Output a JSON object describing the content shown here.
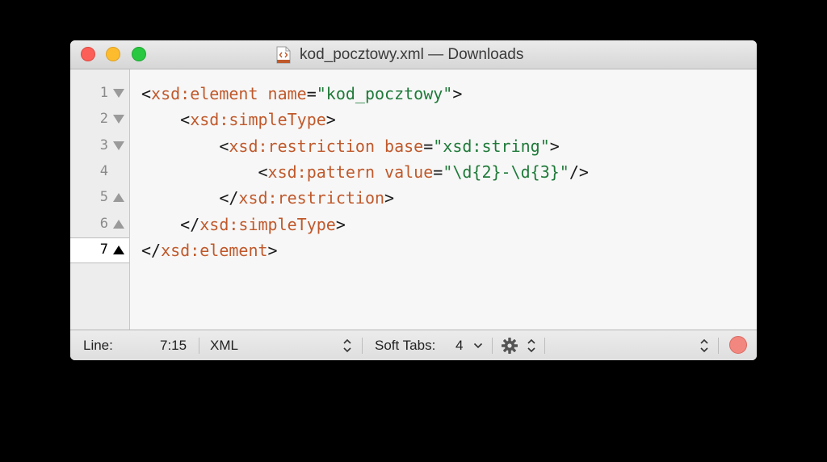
{
  "window": {
    "title": "kod_pocztowy.xml — Downloads"
  },
  "gutter": {
    "lines": [
      {
        "number": "1",
        "fold": "down"
      },
      {
        "number": "2",
        "fold": "down"
      },
      {
        "number": "3",
        "fold": "down"
      },
      {
        "number": "4",
        "fold": ""
      },
      {
        "number": "5",
        "fold": "up"
      },
      {
        "number": "6",
        "fold": "up"
      },
      {
        "number": "7",
        "fold": "up"
      }
    ],
    "current_line": "7"
  },
  "code": {
    "l1": {
      "t1": "<",
      "t2": "xsd:element",
      "t3": " ",
      "t4": "name",
      "t5": "=",
      "t6": "\"kod_pocztowy\"",
      "t7": ">"
    },
    "l2": {
      "indent": "    ",
      "t1": "<",
      "t2": "xsd:simpleType",
      "t3": ">"
    },
    "l3": {
      "indent": "        ",
      "t1": "<",
      "t2": "xsd:restriction",
      "t3": " ",
      "t4": "base",
      "t5": "=",
      "t6": "\"xsd:string\"",
      "t7": ">"
    },
    "l4": {
      "indent": "            ",
      "t1": "<",
      "t2": "xsd:pattern",
      "t3": " ",
      "t4": "value",
      "t5": "=",
      "t6": "\"\\d{2}-\\d{3}\"",
      "t7": "/>"
    },
    "l5": {
      "indent": "        ",
      "t1": "</",
      "t2": "xsd:restriction",
      "t3": ">"
    },
    "l6": {
      "indent": "    ",
      "t1": "</",
      "t2": "xsd:simpleType",
      "t3": ">"
    },
    "l7": {
      "t1": "</",
      "t2": "xsd:element",
      "t3": ">"
    }
  },
  "statusbar": {
    "line_label": "Line:",
    "line_value": "7:15",
    "language": "XML",
    "soft_tabs_label": "Soft Tabs:",
    "soft_tabs_value": "4"
  },
  "colors": {
    "tag": "#c0592b",
    "string": "#1f7a39",
    "record": "#f2877f"
  },
  "icons": [
    "file-xml-icon",
    "fold-arrow-icon",
    "updown-chevron-icon",
    "chevron-down-icon",
    "gear-icon",
    "record-icon"
  ]
}
